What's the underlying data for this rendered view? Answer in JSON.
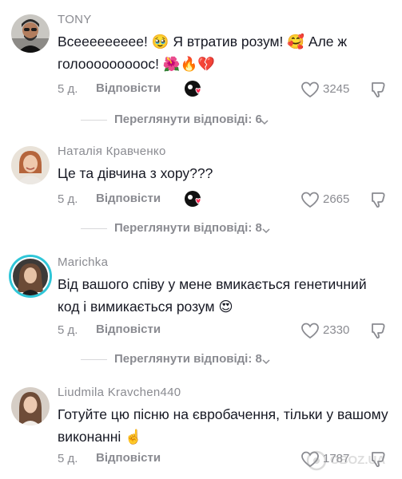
{
  "comments": [
    {
      "username": "TONY",
      "text": "Всеееееееее! 🥹 Я втратив розум! 🥰 Але ж голооооооооос! 🌺🔥💔",
      "date": "5 д.",
      "reply_label": "Відповісти",
      "likes": "3245",
      "view_replies": "Переглянути відповіді: 6",
      "creator_liked": true
    },
    {
      "username": "Наталія Кравченко",
      "text": "Це та дівчина з хору???",
      "date": "5 д.",
      "reply_label": "Відповісти",
      "likes": "2665",
      "view_replies": "Переглянути відповіді: 8",
      "creator_liked": true
    },
    {
      "username": "Marichka",
      "text": "Від вашого співу у мене вмикається генетичний код і вимикається розум 😍",
      "date": "5 д.",
      "reply_label": "Відповісти",
      "likes": "2330",
      "view_replies": "Переглянути відповіді: 8",
      "creator_liked": false
    },
    {
      "username": "Liudmila Kravchen440",
      "text": "Готуйте цю пісню на євробачення, тільки у вашому виконанні ☝️",
      "date": "5 д.",
      "reply_label": "Відповісти",
      "likes": "1787",
      "creator_liked": false
    }
  ],
  "watermark": {
    "text": "OBOZ.UA",
    "icon": "eye-logo-icon"
  },
  "colors": {
    "text": "#161823",
    "muted": "#8a8b91",
    "ring": "#2fc6d8",
    "heart": "#fe2c55"
  }
}
